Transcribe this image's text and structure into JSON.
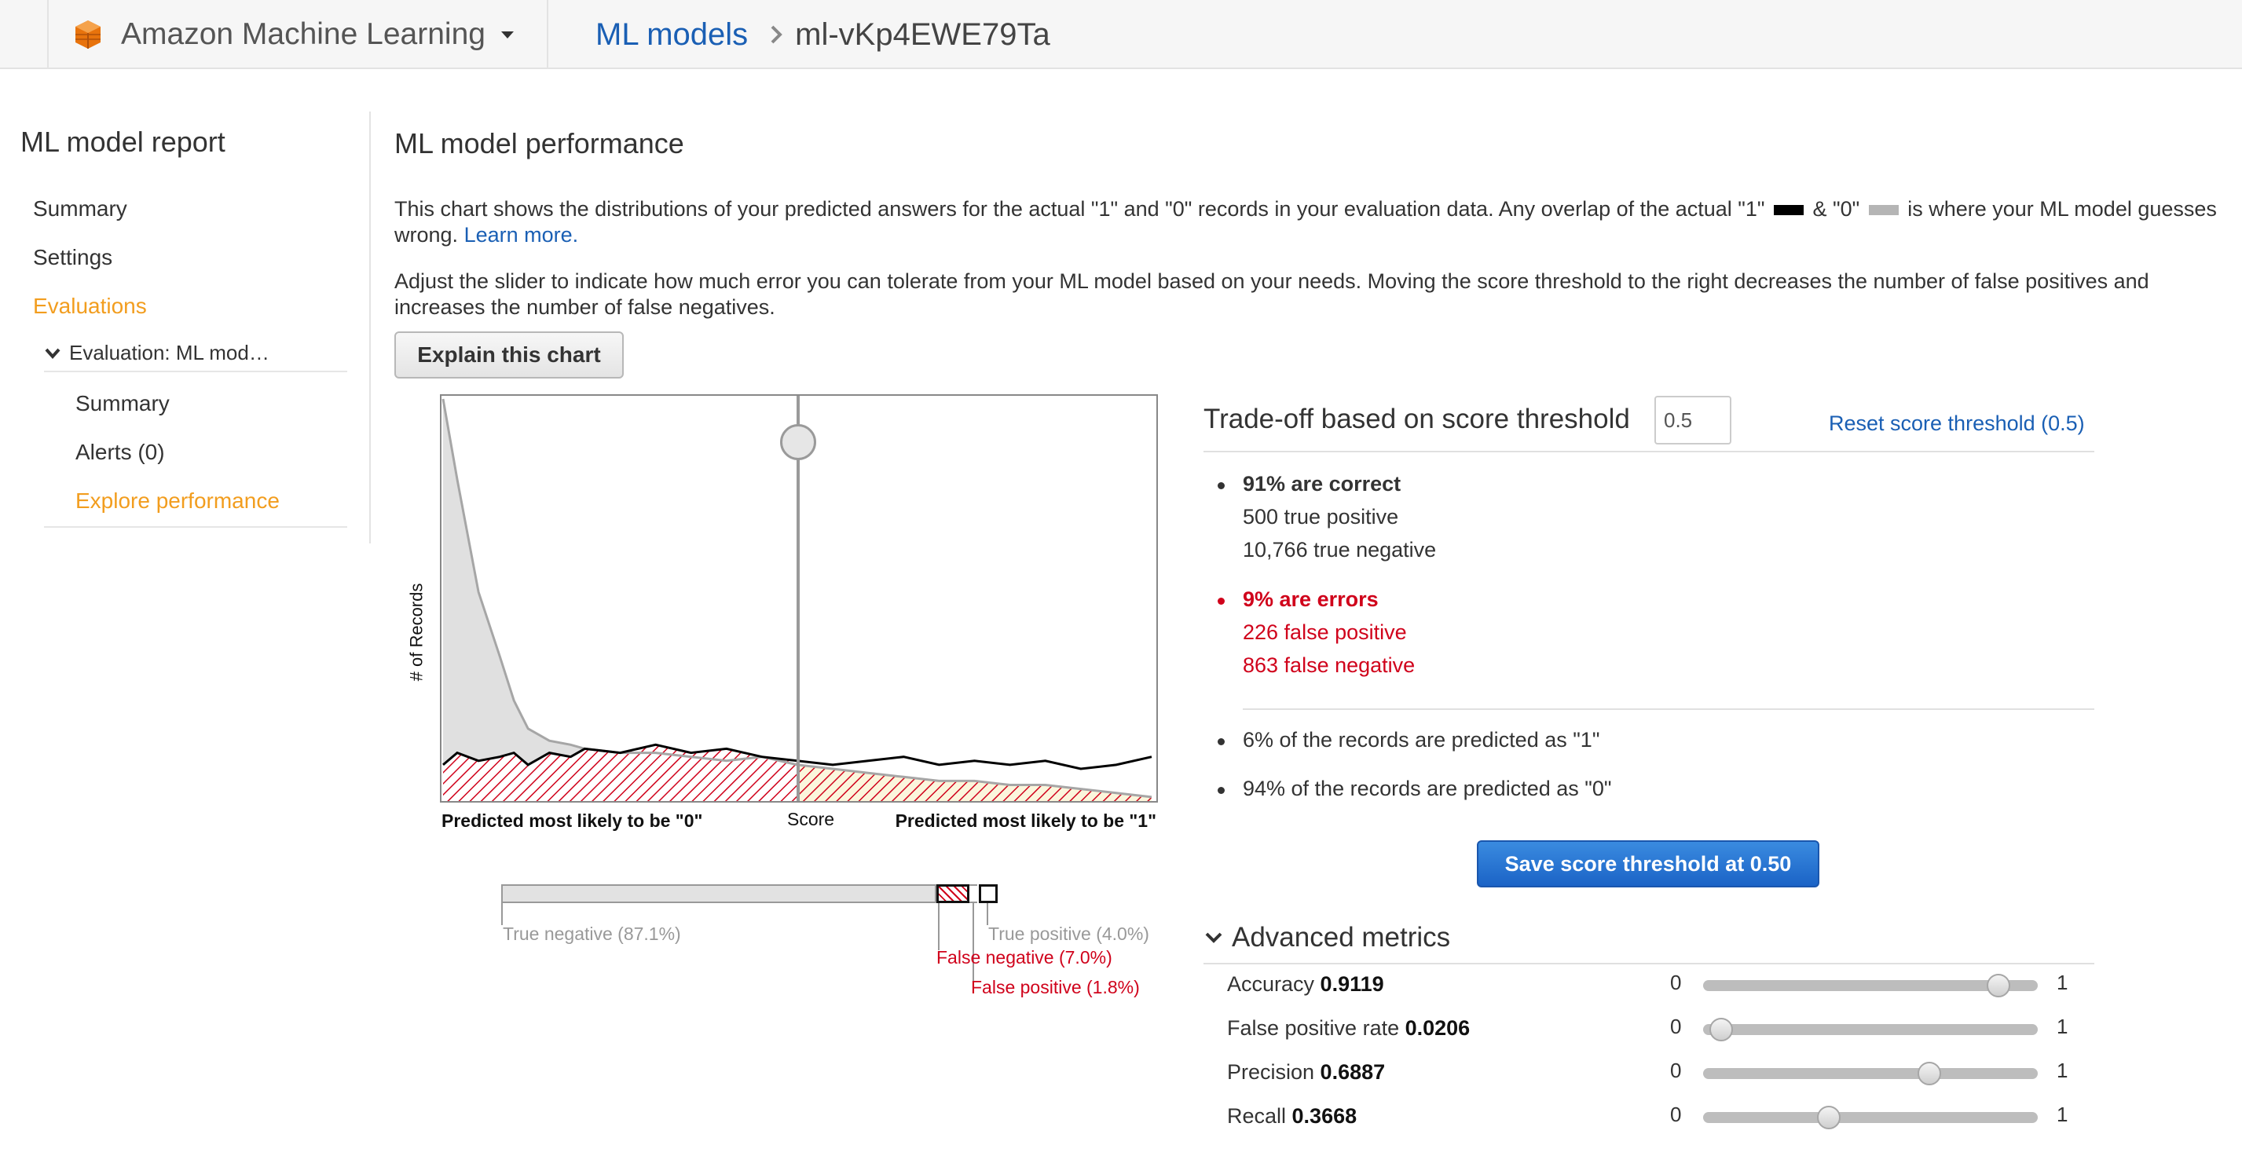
{
  "topbar": {
    "service_name": "Amazon Machine Learning",
    "breadcrumb_link": "ML models",
    "breadcrumb_current": "ml-vKp4EWE79Ta"
  },
  "sidebar": {
    "title": "ML model report",
    "items": [
      {
        "label": "Summary"
      },
      {
        "label": "Settings"
      },
      {
        "label": "Evaluations"
      }
    ],
    "evaluation": {
      "label": "Evaluation: ML mod…",
      "children": [
        {
          "label": "Summary"
        },
        {
          "label": "Alerts (0)"
        },
        {
          "label": "Explore performance"
        }
      ]
    }
  },
  "main": {
    "title": "ML model performance",
    "para1_a": "This chart shows the distributions of your predicted answers for the actual \"1\" and \"0\" records in your evaluation data. Any overlap of the actual \"1\"",
    "para1_b": "& \"0\"",
    "para1_c": "is where your ML model guesses wrong.",
    "learn_more": "Learn more.",
    "para2": "Adjust the slider to indicate how much error you can tolerate from your ML model based on your needs. Moving the score threshold to the right decreases the number of false positives and increases the number of false negatives.",
    "explain_button": "Explain this chart"
  },
  "chart": {
    "y_label": "# of Records",
    "x_left": "Predicted most likely to be \"0\"",
    "x_mid": "Score",
    "x_right": "Predicted most likely to be \"1\"",
    "colors": {
      "actual_1": "#000000",
      "actual_0": "#b5b5b5",
      "error": "#d0021b"
    }
  },
  "chart_data": {
    "type": "area",
    "x": [
      0.0,
      0.02,
      0.05,
      0.08,
      0.1,
      0.12,
      0.15,
      0.18,
      0.2,
      0.25,
      0.3,
      0.35,
      0.4,
      0.45,
      0.5,
      0.55,
      0.6,
      0.65,
      0.7,
      0.75,
      0.8,
      0.85,
      0.9,
      0.95,
      1.0
    ],
    "series": [
      {
        "values": [
          100,
          80,
          52,
          36,
          25,
          18,
          15,
          14,
          13,
          12,
          12,
          11,
          10,
          11,
          9,
          8,
          7,
          6,
          5,
          5,
          4,
          4,
          3,
          2,
          1
        ]
      },
      {
        "values": [
          9,
          12,
          10,
          11,
          12,
          9,
          12,
          11,
          13,
          12,
          14,
          12,
          13,
          11,
          10,
          9,
          10,
          11,
          9,
          10,
          9,
          10,
          8,
          9,
          11
        ]
      }
    ],
    "threshold": 0.5,
    "xlim": [
      0,
      1
    ]
  },
  "proportions": {
    "true_negative": "True negative (87.1%)",
    "false_negative": "False negative (7.0%)",
    "false_positive": "False positive (1.8%)",
    "true_positive": "True positive (4.0%)",
    "tn_pct": 87.1,
    "fn_pct": 7.0,
    "fp_pct": 1.8,
    "tp_pct": 4.0
  },
  "tradeoff": {
    "title": "Trade-off based on score threshold",
    "threshold_value": "0.5",
    "reset_link": "Reset score threshold (0.5)",
    "correct_heading": "91% are correct",
    "true_positive": "500 true positive",
    "true_negative": "10,766 true negative",
    "errors_heading": "9% are errors",
    "false_positive": "226 false positive",
    "false_negative": "863 false negative",
    "predicted_1": "6% of the records are predicted as \"1\"",
    "predicted_0": "94% of the records are predicted as \"0\"",
    "save_button": "Save score threshold at 0.50",
    "error_color": "#d0021b"
  },
  "advanced": {
    "heading": "Advanced metrics",
    "min_label": "0",
    "max_label": "1",
    "metrics": [
      {
        "name": "Accuracy",
        "value_text": "0.9119",
        "value": 0.9119
      },
      {
        "name": "False positive rate",
        "value_text": "0.0206",
        "value": 0.0206
      },
      {
        "name": "Precision",
        "value_text": "0.6887",
        "value": 0.6887
      },
      {
        "name": "Recall",
        "value_text": "0.3668",
        "value": 0.3668
      }
    ]
  }
}
